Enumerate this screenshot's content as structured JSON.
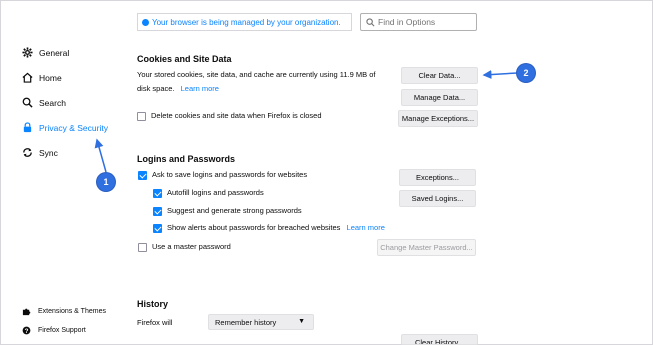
{
  "notice": {
    "text": "Your browser is being managed by your organization."
  },
  "search": {
    "placeholder": "Find in Options"
  },
  "sidebar": {
    "items": [
      {
        "label": "General",
        "icon": "gear-icon"
      },
      {
        "label": "Home",
        "icon": "home-icon"
      },
      {
        "label": "Search",
        "icon": "search-icon"
      },
      {
        "label": "Privacy & Security",
        "icon": "lock-icon",
        "active": true
      },
      {
        "label": "Sync",
        "icon": "sync-icon"
      }
    ],
    "footer": [
      {
        "label": "Extensions & Themes",
        "icon": "puzzle-icon"
      },
      {
        "label": "Firefox Support",
        "icon": "help-icon"
      }
    ]
  },
  "cookies": {
    "title": "Cookies and Site Data",
    "desc1": "Your stored cookies, site data, and cache are currently using 11.9 MB of",
    "desc2": "disk space.",
    "learn_more": "Learn more",
    "delete_on_close": "Delete cookies and site data when Firefox is closed",
    "clear_button": "Clear Data...",
    "manage_button": "Manage Data...",
    "exceptions_button": "Manage Exceptions..."
  },
  "logins": {
    "title": "Logins and Passwords",
    "ask_save": "Ask to save logins and passwords for websites",
    "autofill": "Autofill logins and passwords",
    "suggest": "Suggest and generate strong passwords",
    "alerts": "Show alerts about passwords for breached websites",
    "learn_more": "Learn more",
    "master": "Use a master password",
    "exceptions_button": "Exceptions...",
    "saved_button": "Saved Logins...",
    "change_master_button": "Change Master Password..."
  },
  "history": {
    "title": "History",
    "firefox_will": "Firefox will",
    "mode": "Remember history",
    "clear_button": "Clear History..."
  },
  "annotations": {
    "one": "1",
    "two": "2"
  },
  "colors": {
    "accent": "#0a84ff",
    "badge": "#2f6fe0"
  }
}
